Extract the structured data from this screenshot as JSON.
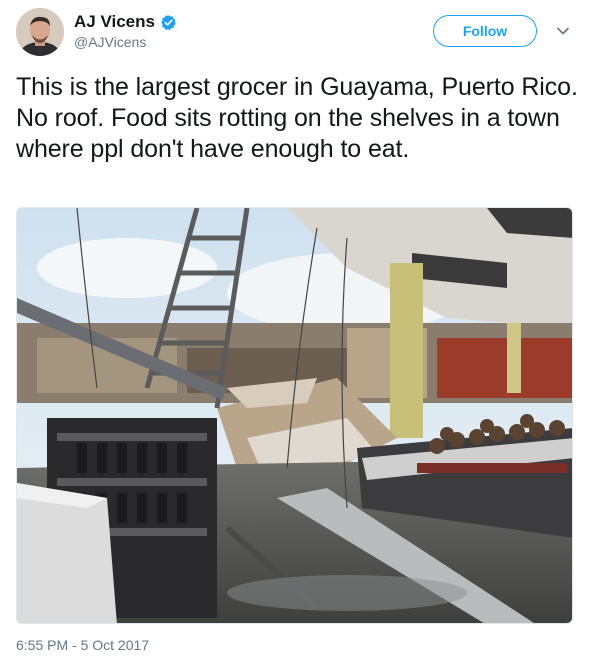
{
  "user": {
    "name": "AJ Vicens",
    "handle": "@AJVicens",
    "verified": true,
    "avatar_icon": "profile-photo"
  },
  "follow_label": "Follow",
  "menu_icon": "chevron-down-icon",
  "tweet_text": "This is the largest grocer in Guayama, Puerto Rico. No roof. Food sits rotting on the shelves in a town where ppl don't have enough to eat.",
  "media": {
    "kind": "photo"
  },
  "timestamp": "6:55 PM - 5 Oct 2017",
  "colors": {
    "accent": "#1da1f2",
    "text": "#14171a",
    "secondary": "#657786"
  }
}
